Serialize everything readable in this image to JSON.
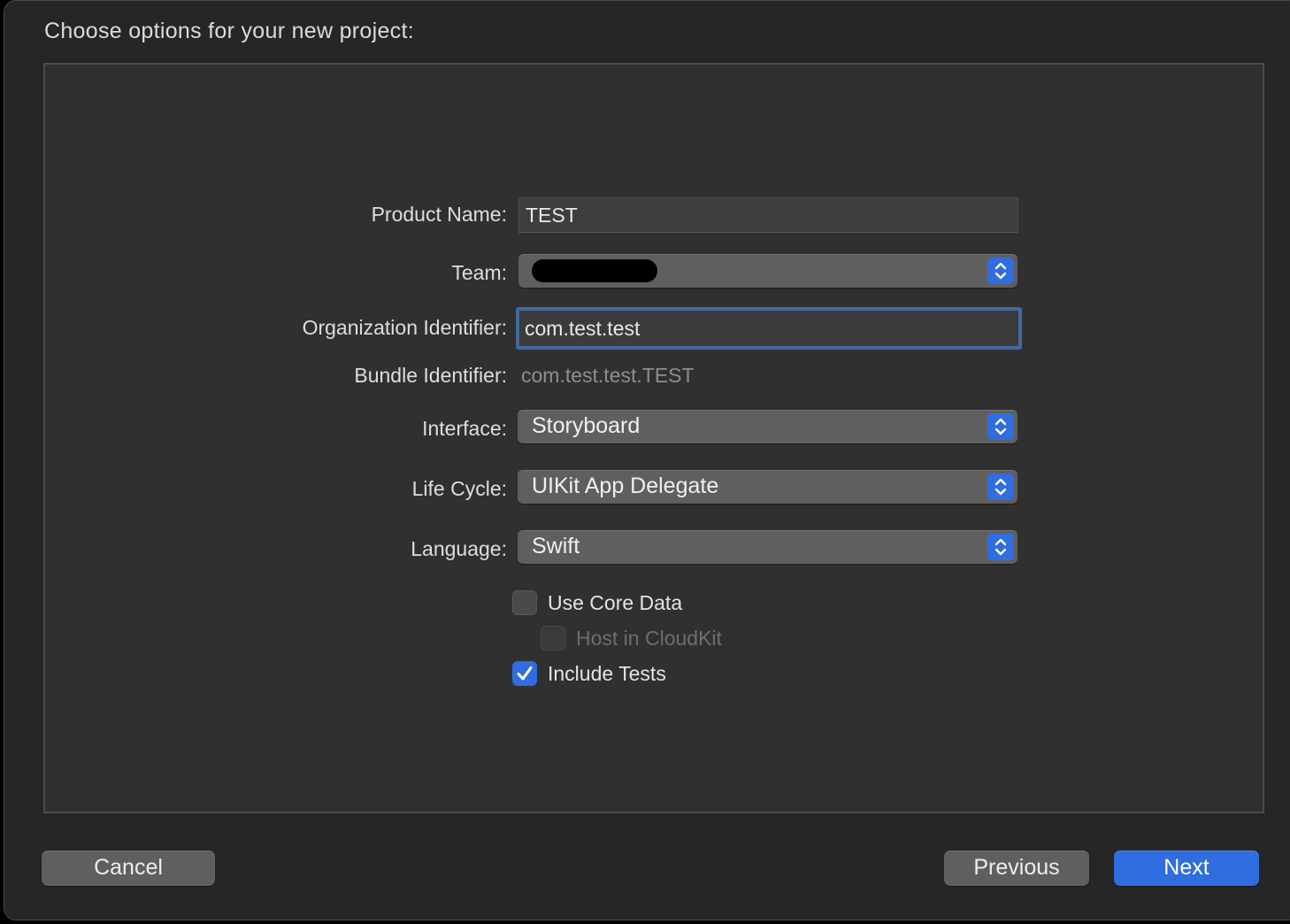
{
  "dialog": {
    "heading": "Choose options for your new project:"
  },
  "form": {
    "product_name": {
      "label": "Product Name:",
      "value": "TEST"
    },
    "team": {
      "label": "Team:",
      "value_redacted": true
    },
    "organization_identifier": {
      "label": "Organization Identifier:",
      "value": "com.test.test"
    },
    "bundle_identifier": {
      "label": "Bundle Identifier:",
      "value": "com.test.test.TEST"
    },
    "interface": {
      "label": "Interface:",
      "value": "Storyboard"
    },
    "life_cycle": {
      "label": "Life Cycle:",
      "value": "UIKit App Delegate"
    },
    "language": {
      "label": "Language:",
      "value": "Swift"
    }
  },
  "options": {
    "use_core_data": {
      "label": "Use Core Data",
      "checked": false,
      "enabled": true
    },
    "host_in_cloudkit": {
      "label": "Host in CloudKit",
      "checked": false,
      "enabled": false
    },
    "include_tests": {
      "label": "Include Tests",
      "checked": true,
      "enabled": true
    }
  },
  "buttons": {
    "cancel": "Cancel",
    "previous": "Previous",
    "next": "Next"
  },
  "colors": {
    "accent": "#2f6de0",
    "focus_ring": "#3f6a9e",
    "window_bg": "#262627",
    "panel_bg": "#303031"
  },
  "icons": {
    "popup_stepper": "up-down-chevron-icon",
    "checkmark": "checkmark-icon"
  }
}
